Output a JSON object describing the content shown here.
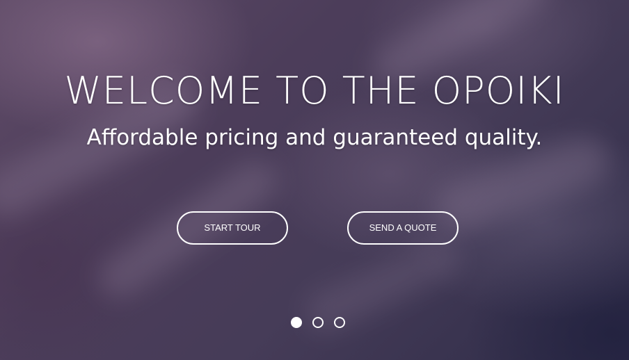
{
  "hero": {
    "title": "WELCOME TO THE OPOIKI",
    "subtitle": "Affordable pricing and guaranteed quality.",
    "background_colors": [
      "#5e4a66",
      "#463c58",
      "#2e2c48"
    ]
  },
  "buttons": {
    "start_tour": "START TOUR",
    "send_quote": "SEND A QUOTE"
  },
  "carousel": {
    "slide_count": 3,
    "active_index": 0
  }
}
